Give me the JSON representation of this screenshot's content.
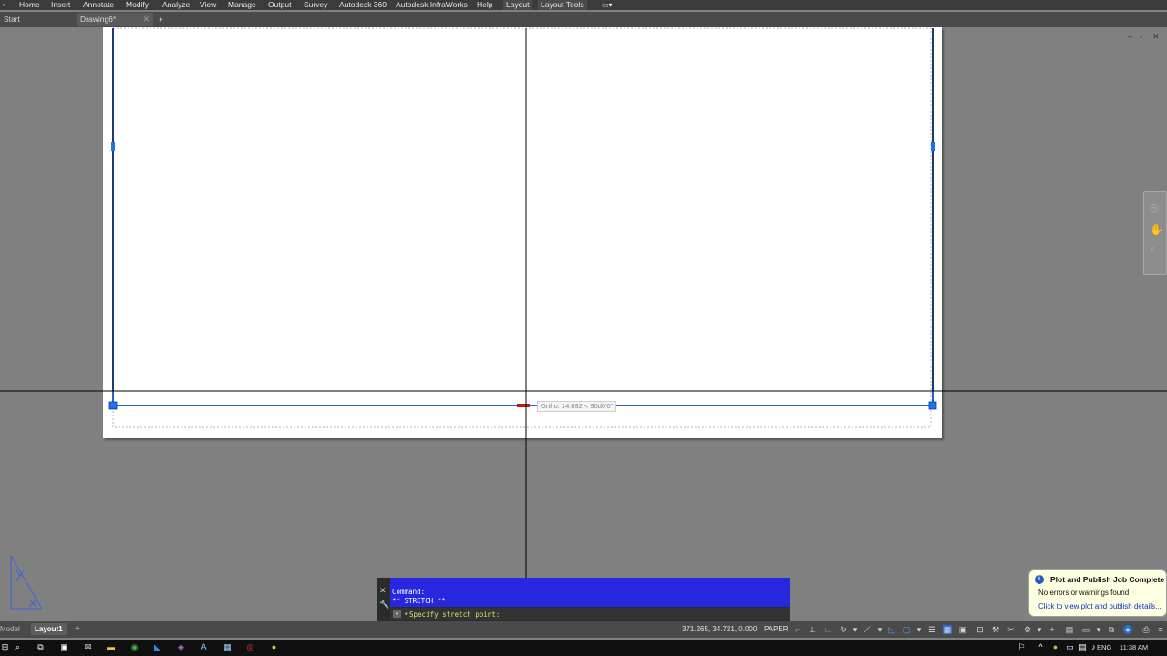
{
  "menu": {
    "items": [
      "Home",
      "Insert",
      "Annotate",
      "Modify",
      "Analyze",
      "View",
      "Manage",
      "Output",
      "Survey",
      "Autodesk 360",
      "Autodesk InfraWorks",
      "Help",
      "Layout",
      "Layout Tools"
    ]
  },
  "tabs": [
    {
      "label": "Start"
    },
    {
      "label": "Drawing6*"
    }
  ],
  "new_tab_symbol": "+",
  "tooltip": {
    "text": "Ortho: 14.892 < 90d0'0\""
  },
  "command": {
    "history": [
      "Command:",
      "** STRETCH **"
    ],
    "prompt": "Specify stretch point:"
  },
  "layout_tabs": [
    {
      "label": "Model"
    },
    {
      "label": "Layout1"
    }
  ],
  "layout_add": "+",
  "status": {
    "coordinates": "371.265, 34.721, 0.000",
    "space": "PAPER"
  },
  "notification": {
    "title": "Plot and Publish Job Complete",
    "message": "No errors or warnings found",
    "link": "Click to view plot and publish details..."
  },
  "taskbar": {
    "language": "ENG",
    "time": "11:38 AM"
  },
  "colors": {
    "menubar": "#3b3b3b",
    "paper": "#ffffff",
    "background": "#808080",
    "selection_blue": "#2b5fd0",
    "command_bg": "#2727e0",
    "notification_bg": "#ffffe1"
  }
}
